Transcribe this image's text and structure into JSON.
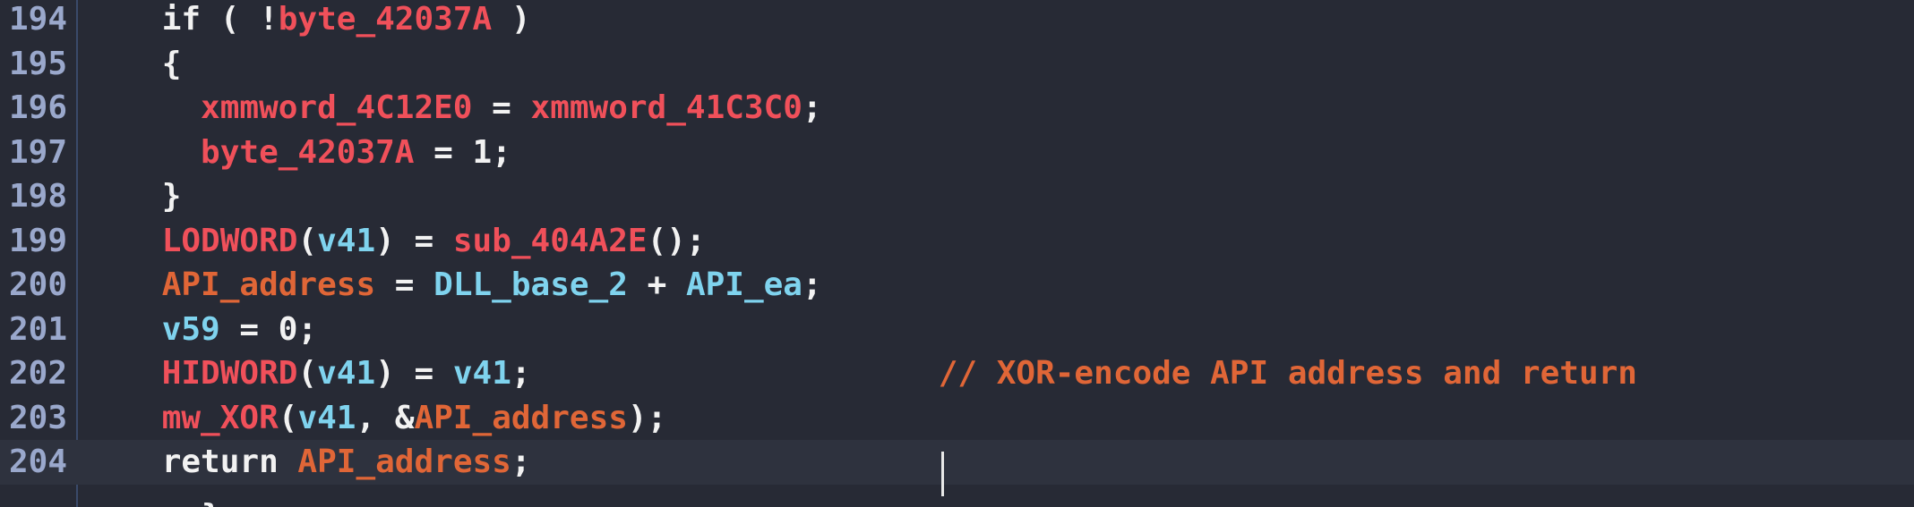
{
  "editor": {
    "lines": [
      {
        "num": "194",
        "indent": "    ",
        "tokens": [
          {
            "t": "if ( !",
            "c": "kw"
          },
          {
            "t": "byte_42037A",
            "c": "gv"
          },
          {
            "t": " )",
            "c": "pn"
          }
        ]
      },
      {
        "num": "195",
        "indent": "    ",
        "tokens": [
          {
            "t": "{",
            "c": "pn"
          }
        ]
      },
      {
        "num": "196",
        "indent": "      ",
        "tokens": [
          {
            "t": "xmmword_4C12E0",
            "c": "gv"
          },
          {
            "t": " = ",
            "c": "pn"
          },
          {
            "t": "xmmword_41C3C0",
            "c": "gv"
          },
          {
            "t": ";",
            "c": "pn"
          }
        ]
      },
      {
        "num": "197",
        "indent": "      ",
        "tokens": [
          {
            "t": "byte_42037A",
            "c": "gv"
          },
          {
            "t": " = 1;",
            "c": "pn"
          }
        ]
      },
      {
        "num": "198",
        "indent": "    ",
        "tokens": [
          {
            "t": "}",
            "c": "pn"
          }
        ]
      },
      {
        "num": "199",
        "indent": "    ",
        "tokens": [
          {
            "t": "LODWORD",
            "c": "fn"
          },
          {
            "t": "(",
            "c": "pn"
          },
          {
            "t": "v41",
            "c": "lv"
          },
          {
            "t": ") = ",
            "c": "pn"
          },
          {
            "t": "sub_404A2E",
            "c": "fn"
          },
          {
            "t": "();",
            "c": "pn"
          }
        ]
      },
      {
        "num": "200",
        "indent": "    ",
        "tokens": [
          {
            "t": "API_address",
            "c": "ap"
          },
          {
            "t": " = ",
            "c": "pn"
          },
          {
            "t": "DLL_base_2",
            "c": "lv"
          },
          {
            "t": " + ",
            "c": "pn"
          },
          {
            "t": "API_ea",
            "c": "lv"
          },
          {
            "t": ";",
            "c": "pn"
          }
        ]
      },
      {
        "num": "201",
        "indent": "    ",
        "tokens": [
          {
            "t": "v59",
            "c": "lv"
          },
          {
            "t": " = 0;",
            "c": "pn"
          }
        ]
      },
      {
        "num": "202",
        "indent": "    ",
        "tokens": [
          {
            "t": "HIDWORD",
            "c": "fn"
          },
          {
            "t": "(",
            "c": "pn"
          },
          {
            "t": "v41",
            "c": "lv"
          },
          {
            "t": ") = ",
            "c": "pn"
          },
          {
            "t": "v41",
            "c": "lv"
          },
          {
            "t": ";                     ",
            "c": "pn"
          },
          {
            "t": "// XOR-encode API address and return",
            "c": "cm"
          }
        ]
      },
      {
        "num": "203",
        "indent": "    ",
        "tokens": [
          {
            "t": "mw_XOR",
            "c": "fn"
          },
          {
            "t": "(",
            "c": "pn"
          },
          {
            "t": "v41",
            "c": "lv"
          },
          {
            "t": ", &",
            "c": "pn"
          },
          {
            "t": "API_address",
            "c": "ap"
          },
          {
            "t": ");",
            "c": "pn"
          }
        ]
      },
      {
        "num": "204",
        "indent": "    ",
        "current": true,
        "tokens": [
          {
            "t": "return ",
            "c": "kw"
          },
          {
            "t": "API_address",
            "c": "ap"
          },
          {
            "t": ";",
            "c": "pn"
          }
        ]
      }
    ],
    "top_partial": "}",
    "bottom_partial": "}"
  },
  "colors": {
    "background": "#272a35",
    "current_line": "#2e323e",
    "line_number": "#9aa8cc",
    "global_var": "#f0505a",
    "local_var": "#7fd3ee",
    "renamed": "#e06637",
    "comment": "#e06637",
    "text": "#f2f2f2"
  }
}
